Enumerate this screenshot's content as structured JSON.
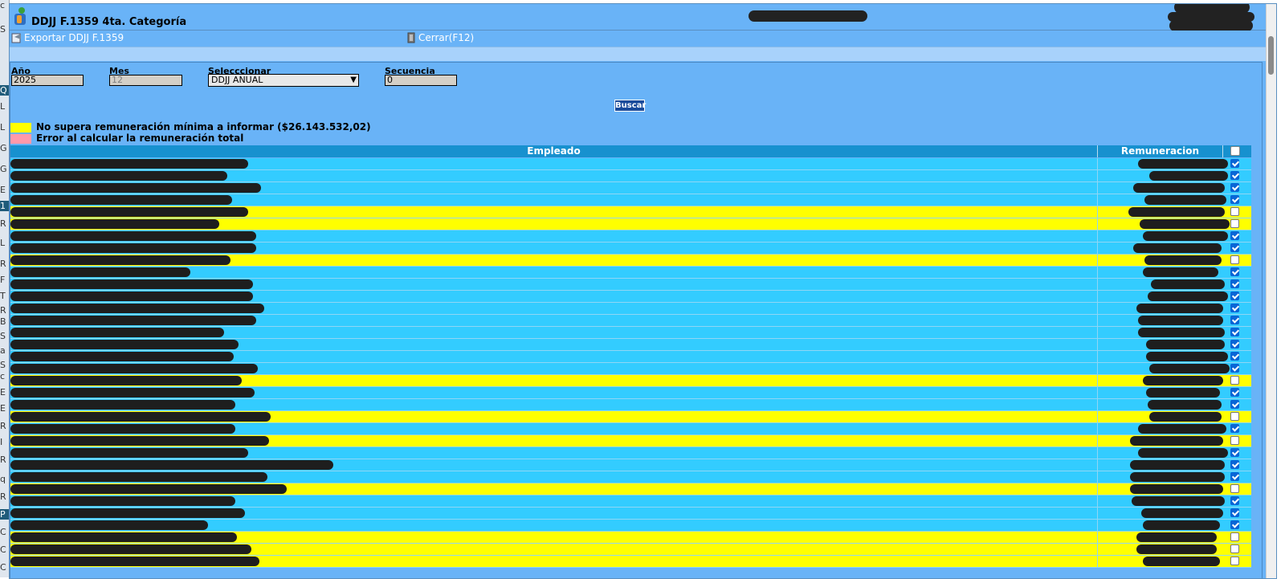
{
  "window": {
    "title": "DDJJ F.1359 4ta. Categoría",
    "toolbar": {
      "export_label": "Exportar DDJJ F.1359",
      "close_label": "Cerrar(F12)"
    }
  },
  "form": {
    "anio": {
      "label": "Año",
      "value": "2025"
    },
    "mes": {
      "label": "Mes",
      "value": "12"
    },
    "seleccionar": {
      "label": "Selecccionar",
      "value": "DDJJ ANUAL"
    },
    "secuencia": {
      "label": "Secuencia",
      "value": "0"
    },
    "buscar_label": "Buscar"
  },
  "legend": [
    {
      "color": "#ffff00",
      "text": "No supera remuneración mínima a informar ($26.143.532,02)"
    },
    {
      "color": "#ff99aa",
      "text": "Error al calcular la remuneración total"
    }
  ],
  "grid": {
    "headers": {
      "empleado": "Empleado",
      "remuneracion": "Remuneracion"
    },
    "rows": [
      {
        "checked": true,
        "highlight": false
      },
      {
        "checked": true,
        "highlight": false
      },
      {
        "checked": true,
        "highlight": false
      },
      {
        "checked": true,
        "highlight": false
      },
      {
        "checked": false,
        "highlight": true
      },
      {
        "checked": false,
        "highlight": true
      },
      {
        "checked": true,
        "highlight": false
      },
      {
        "checked": true,
        "highlight": false
      },
      {
        "checked": false,
        "highlight": true
      },
      {
        "checked": true,
        "highlight": false
      },
      {
        "checked": true,
        "highlight": false
      },
      {
        "checked": true,
        "highlight": false
      },
      {
        "checked": true,
        "highlight": false
      },
      {
        "checked": true,
        "highlight": false
      },
      {
        "checked": true,
        "highlight": false
      },
      {
        "checked": true,
        "highlight": false
      },
      {
        "checked": true,
        "highlight": false
      },
      {
        "checked": true,
        "highlight": false
      },
      {
        "checked": false,
        "highlight": true
      },
      {
        "checked": true,
        "highlight": false
      },
      {
        "checked": true,
        "highlight": false
      },
      {
        "checked": false,
        "highlight": true
      },
      {
        "checked": true,
        "highlight": false
      },
      {
        "checked": false,
        "highlight": true
      },
      {
        "checked": true,
        "highlight": false
      },
      {
        "checked": true,
        "highlight": false
      },
      {
        "checked": true,
        "highlight": false
      },
      {
        "checked": false,
        "highlight": true
      },
      {
        "checked": true,
        "highlight": false
      },
      {
        "checked": true,
        "highlight": false
      },
      {
        "checked": true,
        "highlight": false
      },
      {
        "checked": false,
        "highlight": true
      },
      {
        "checked": false,
        "highlight": true
      },
      {
        "checked": false,
        "highlight": true
      }
    ]
  },
  "background_letters": [
    "c",
    "S",
    "Q",
    "L",
    "L",
    "G",
    "G",
    "E",
    "1",
    "R",
    "L",
    "R",
    "F",
    "T",
    "R",
    "B",
    "S",
    "a",
    "S",
    "c",
    "E",
    "E",
    "R",
    "I",
    "R",
    "q",
    "R",
    "P",
    "C",
    "C",
    "C"
  ],
  "colors": {
    "window_bg": "#69b3f7",
    "row_normal": "#33ccff",
    "row_highlight": "#ffff00",
    "header_bg": "#1791cf",
    "buscar_bg": "#1a4b9b"
  }
}
